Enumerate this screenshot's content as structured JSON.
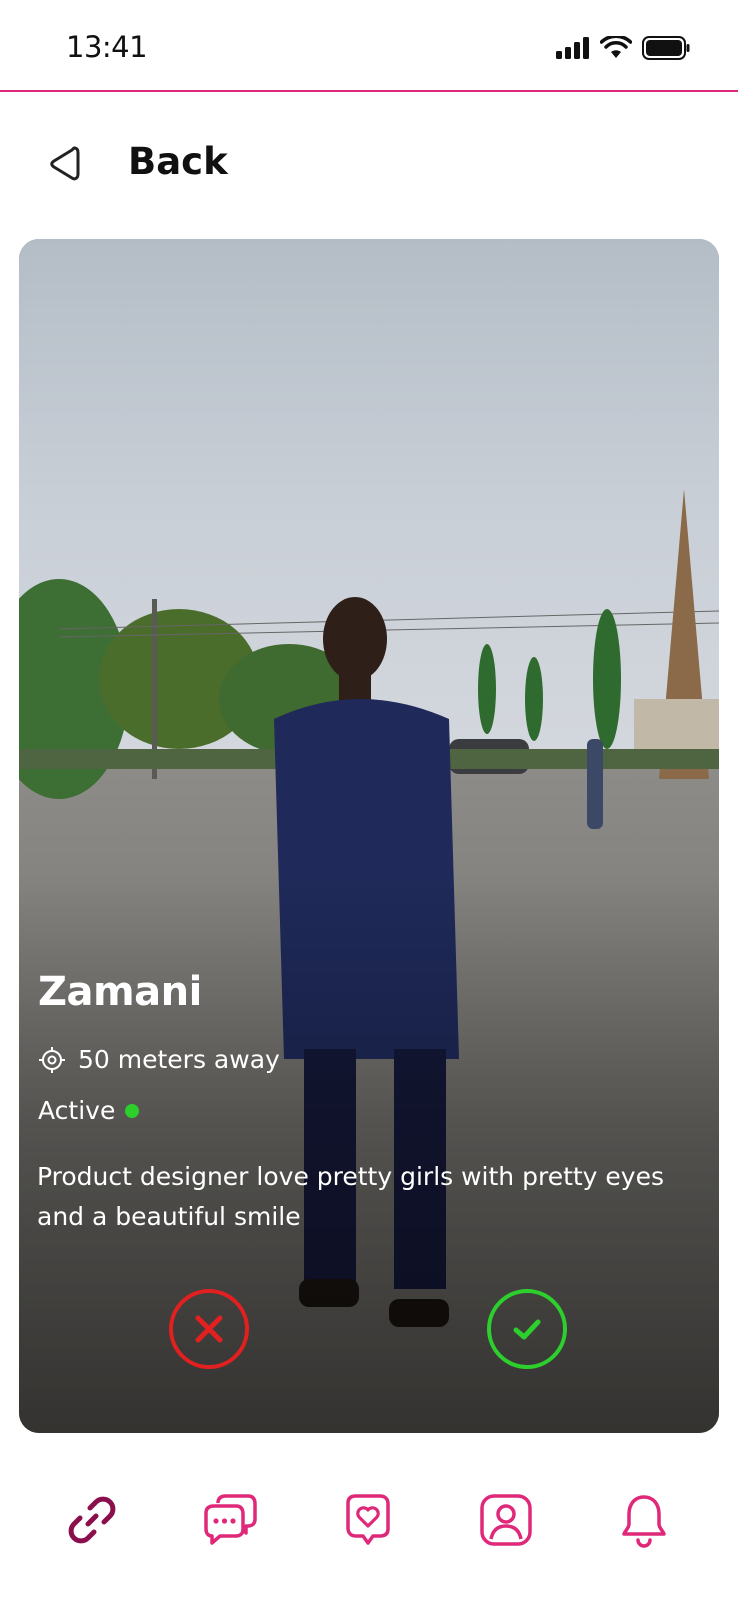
{
  "status_bar": {
    "time": "13:41"
  },
  "header": {
    "back_label": "Back"
  },
  "profile": {
    "name": "Zamani",
    "distance": "50 meters away",
    "status": "Active",
    "bio": "Product designer love pretty girls with pretty eyes and a beautiful smile"
  },
  "icons": {
    "back": "back-triangle-icon",
    "location": "location-target-icon",
    "reject": "close-icon",
    "accept": "check-icon",
    "nav": [
      "link-icon",
      "chat-icon",
      "heart-icon",
      "profile-icon",
      "bell-icon"
    ]
  },
  "colors": {
    "accent": "#e0287a",
    "reject": "#e32020",
    "accept": "#2ccf2c",
    "nav_active": "#8a0f4c"
  }
}
